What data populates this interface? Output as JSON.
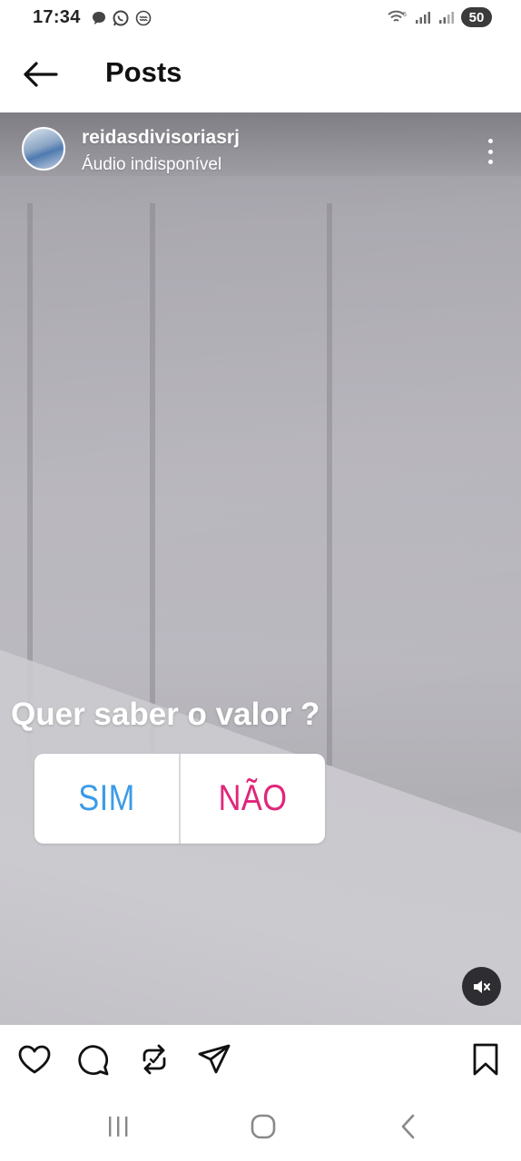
{
  "status_bar": {
    "time": "17:34",
    "battery": "50",
    "left_icons": [
      "message-bubble-icon",
      "whatsapp-icon",
      "notification-icon"
    ],
    "right_icons": [
      "wifi-icon",
      "signal-icon",
      "signal-icon"
    ]
  },
  "header": {
    "title": "Posts"
  },
  "post": {
    "username": "reidasdivisoriasrj",
    "audio_status": "Áudio indisponível",
    "poll": {
      "question": "Quer saber o valor ?",
      "options": [
        {
          "label": "SIM",
          "color": "#3b9be8"
        },
        {
          "label": "NÃO",
          "color": "#e0267a"
        }
      ]
    }
  },
  "actions": [
    "heart-icon",
    "comment-icon",
    "repost-icon",
    "share-icon",
    "bookmark-icon"
  ],
  "nav": [
    "recent-apps-icon",
    "home-icon",
    "back-icon"
  ]
}
